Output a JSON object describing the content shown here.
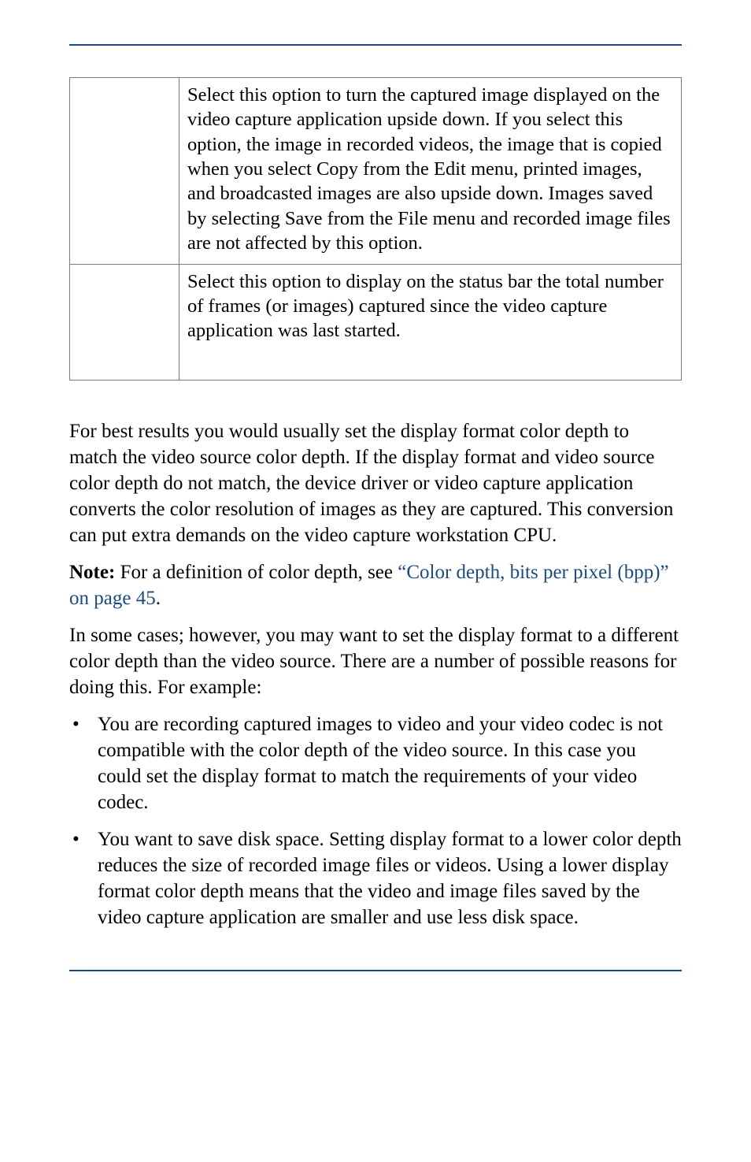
{
  "table": {
    "row1": {
      "label": "",
      "desc": "Select this option to turn the captured image displayed on the video capture application upside down. If you select this option, the image in recorded videos, the image that is copied when you select Copy from the Edit menu, printed images, and broadcasted images are also upside down. Images saved by selecting Save from the File menu and recorded image files are not affected by this option."
    },
    "row2": {
      "label": "",
      "desc": "Select this option to display on the status bar the total number of frames (or images) captured since the video capture application was last started."
    }
  },
  "para1": "For best results you would usually set the display format color depth to match the video source color depth. If the display format and video source color depth do not match, the device driver or video capture application converts the color resolution of images as they are captured. This conversion can put extra demands on the video capture workstation CPU.",
  "note": {
    "label": "Note:",
    "text_before_link": " For a definition of color depth, see ",
    "link_text": "“Color depth, bits per pixel (bpp)” on page 45",
    "after_link": "."
  },
  "para2": "In some cases; however, you may want to set the display format to a different color depth than the video source. There are a number of possible reasons for doing this. For example:",
  "bullets": {
    "b1": "You are recording captured images to video and your video codec is not compatible with the color depth of the video source. In this case you could set the display format to match the requirements of your video codec.",
    "b2": "You want to save disk space. Setting display format to a lower color depth reduces the size of recorded image files or videos. Using a lower display format color depth means that the video and image files saved by the video capture application are smaller and use less disk space."
  }
}
